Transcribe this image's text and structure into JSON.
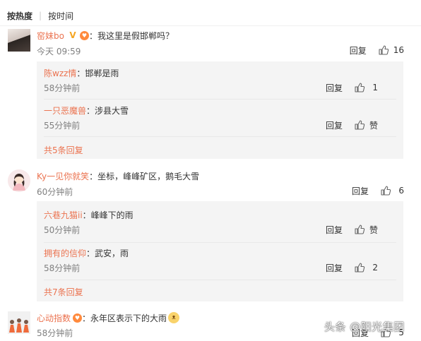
{
  "sort_tabs": {
    "hot": "按热度",
    "time": "按时间"
  },
  "colors": {
    "username": "#eb7350",
    "text": "#333333",
    "meta": "#808080",
    "reply_bg": "#f4f4f4"
  },
  "comments": [
    {
      "username": "窑妹bo",
      "text": "：我这里是假邯郸吗？",
      "time": "今天 09:59",
      "reply_label": "回复",
      "likes": "16",
      "replies": [
        {
          "username": "陈wzz情",
          "text": "：邯郸是雨",
          "time": "58分钟前",
          "reply_label": "回复",
          "likes": "1"
        },
        {
          "username": "一只恶魔兽",
          "text": "：涉县大雪",
          "time": "55分钟前",
          "reply_label": "回复",
          "likes": "赞"
        }
      ],
      "more": "共5条回复"
    },
    {
      "username": "Ky一见你就笑",
      "text": "：坐标，峰峰矿区，鹅毛大雪",
      "time": "60分钟前",
      "reply_label": "回复",
      "likes": "6",
      "replies": [
        {
          "username": "六巷九猫ii",
          "text": "：峰峰下的雨",
          "time": "50分钟前",
          "reply_label": "回复",
          "likes": "赞"
        },
        {
          "username": "拥有的信仰",
          "text": "：武安，雨",
          "time": "58分钟前",
          "reply_label": "回复",
          "likes": "2"
        }
      ],
      "more": "共7条回复"
    },
    {
      "username": "心动指数",
      "text": "：永年区表示下的大雨",
      "time": "58分钟前",
      "reply_label": "回复",
      "likes": "5"
    }
  ],
  "watermark": "头条 @阳光集团"
}
